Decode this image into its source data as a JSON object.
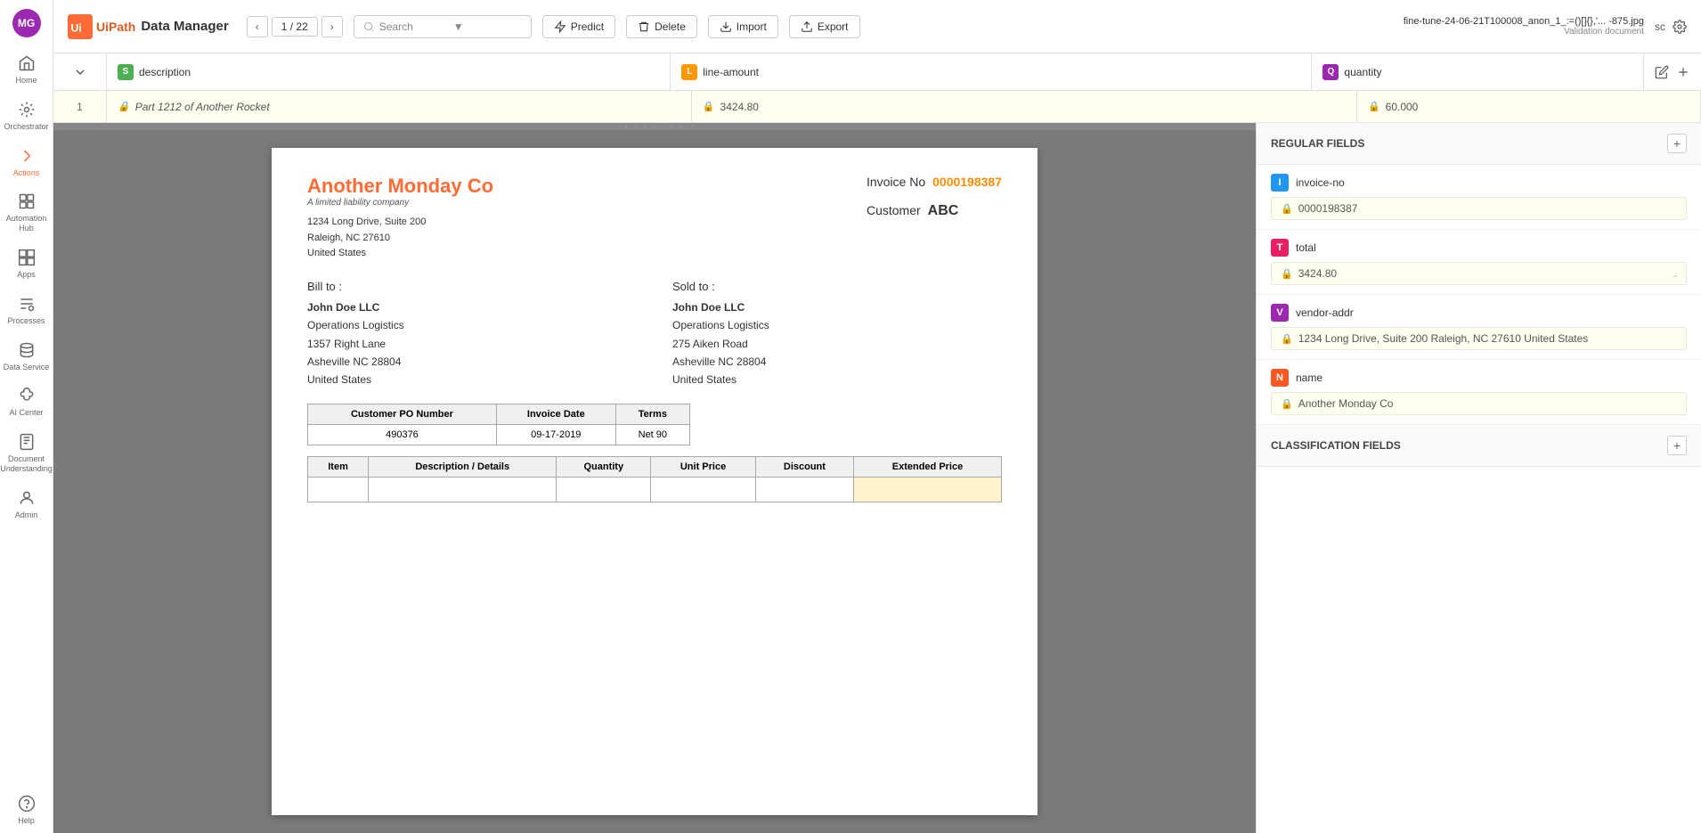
{
  "sidebar": {
    "avatar": "MG",
    "items": [
      {
        "id": "home",
        "label": "Home",
        "icon": "home"
      },
      {
        "id": "orchestrator",
        "label": "Orchestrator",
        "icon": "orchestrator"
      },
      {
        "id": "actions",
        "label": "Actions",
        "icon": "actions",
        "active": true
      },
      {
        "id": "automation-hub",
        "label": "Automation Hub",
        "icon": "automation"
      },
      {
        "id": "apps",
        "label": "Apps",
        "icon": "apps"
      },
      {
        "id": "processes",
        "label": "Processes",
        "icon": "processes"
      },
      {
        "id": "data-service",
        "label": "Data Service",
        "icon": "data"
      },
      {
        "id": "ai-center",
        "label": "AI Center",
        "icon": "ai"
      },
      {
        "id": "document-understanding",
        "label": "Document Understanding",
        "icon": "document"
      },
      {
        "id": "admin",
        "label": "Admin",
        "icon": "admin"
      },
      {
        "id": "help",
        "label": "Help",
        "icon": "help"
      }
    ]
  },
  "toolbar": {
    "brand_logo": "UiPath",
    "brand_title": "Data Manager",
    "page_current": "1",
    "page_total": "22",
    "page_display": "1 / 22",
    "search_placeholder": "Search",
    "predict_label": "Predict",
    "delete_label": "Delete",
    "import_label": "Import",
    "export_label": "Export",
    "file_name": "fine-tune-24-06-21T100008_anon_1_:=()[]{},'... -875.jpg",
    "file_subtitle": "Validation document",
    "settings_label": "sc"
  },
  "table": {
    "toggle_icon": "chevron-down",
    "columns": [
      {
        "id": "description",
        "label": "description",
        "badge": "S",
        "badge_color": "s"
      },
      {
        "id": "line-amount",
        "label": "line-amount",
        "badge": "L",
        "badge_color": "l"
      },
      {
        "id": "quantity",
        "label": "quantity",
        "badge": "Q",
        "badge_color": "q"
      }
    ],
    "rows": [
      {
        "num": "1",
        "description": "Part 1212 of Another Rocket",
        "line_amount": "3424.80",
        "quantity": "60.000"
      }
    ]
  },
  "invoice": {
    "company_name_part1": "Another",
    "company_name_part2": "Monday",
    "company_name_part3": "Co",
    "company_subtitle": "A limited liability company",
    "company_address": "1234 Long Drive, Suite 200\nRaleigh, NC 27610\nUnited States",
    "invoice_no_label": "Invoice No",
    "invoice_no_value": "0000198387",
    "customer_label": "Customer",
    "customer_value": "ABC",
    "bill_to_label": "Bill to :",
    "bill_to_company": "John Doe LLC",
    "bill_to_dept": "Operations Logistics",
    "bill_to_address1": "1357 Right Lane",
    "bill_to_address2": "Asheville  NC 28804",
    "bill_to_country": "United States",
    "sold_to_label": "Sold to :",
    "sold_to_company": "John Doe LLC",
    "sold_to_dept": "Operations Logistics",
    "sold_to_address1": "275 Aiken Road",
    "sold_to_address2": "Asheville  NC 28804",
    "sold_to_country": "United States",
    "po_table": {
      "headers": [
        "Customer PO Number",
        "Invoice Date",
        "Terms"
      ],
      "rows": [
        [
          "490376",
          "09-17-2019",
          "Net 90"
        ]
      ]
    },
    "items_table": {
      "headers": [
        "Item",
        "Description / Details",
        "Quantity",
        "Unit Price",
        "Discount",
        "Extended Price"
      ],
      "rows": []
    }
  },
  "right_panel": {
    "regular_fields_label": "REGULAR FIELDS",
    "classification_fields_label": "CLASSIFICATION FIELDS",
    "fields": [
      {
        "id": "invoice-no",
        "badge": "I",
        "badge_type": "i",
        "label": "invoice-no",
        "value": "0000198387"
      },
      {
        "id": "total",
        "badge": "T",
        "badge_type": "t",
        "label": "total",
        "value": "3424.80"
      },
      {
        "id": "vendor-addr",
        "badge": "V",
        "badge_type": "v",
        "label": "vendor-addr",
        "value": "1234 Long Drive, Suite 200 Raleigh, NC 27610 United States"
      },
      {
        "id": "name",
        "badge": "N",
        "badge_type": "n",
        "label": "name",
        "value": "Another Monday Co"
      }
    ]
  }
}
